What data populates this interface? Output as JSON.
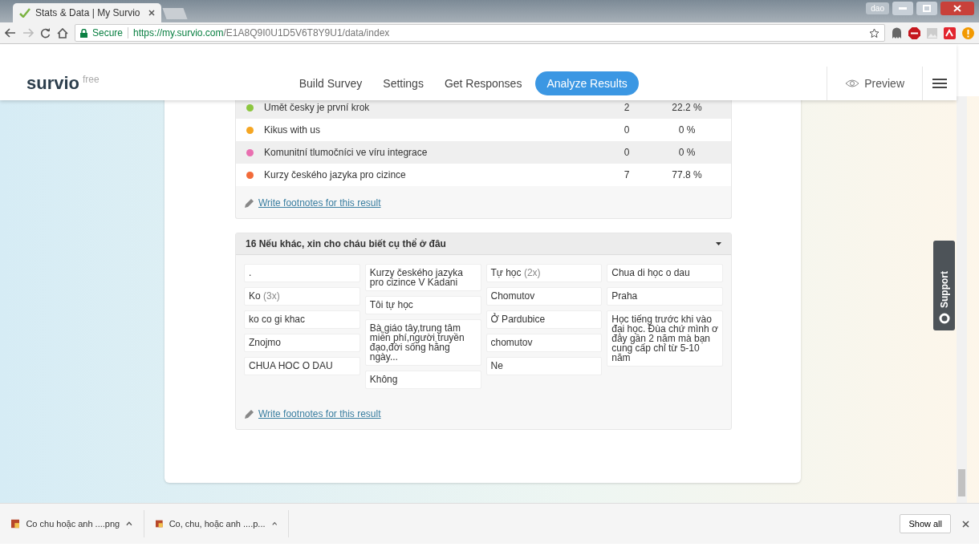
{
  "browser": {
    "tab_title": "Stats & Data | My Survio",
    "secure": "Secure",
    "url_host": "https://my.survio.com",
    "url_path": "/E1A8Q9I0U1D5V6T8Y9U1/data/index",
    "profile": "dao"
  },
  "app": {
    "logo": "survio",
    "plan": "free",
    "nav": [
      {
        "label": "Build Survey",
        "selected": false
      },
      {
        "label": "Settings",
        "selected": false
      },
      {
        "label": "Get Responses",
        "selected": false
      },
      {
        "label": "Analyze Results",
        "selected": true
      }
    ],
    "preview": "Preview"
  },
  "result": {
    "rows": [
      {
        "label": "Umět česky je první krok",
        "count": "2",
        "percent": "22.2 %",
        "color": "#8cc63f"
      },
      {
        "label": "Kikus with us",
        "count": "0",
        "percent": "0 %",
        "color": "#f5a623"
      },
      {
        "label": "Komunitní tlumočníci ve víru integrace",
        "count": "0",
        "percent": "0 %",
        "color": "#e96fb0"
      },
      {
        "label": "Kurzy českého jazyka pro cizince",
        "count": "7",
        "percent": "77.8 %",
        "color": "#f26b3a"
      }
    ],
    "footnote_link": "Write footnotes for this result"
  },
  "question": {
    "title": "16 Nếu khác, xin cho cháu biết cụ thể ở đâu",
    "columns": [
      [
        {
          "text": "."
        },
        {
          "text": "Ko",
          "count": "(3x)"
        },
        {
          "text": "ko co gi khac"
        },
        {
          "text": "Znojmo"
        },
        {
          "text": "CHUA HOC O DAU"
        }
      ],
      [
        {
          "text": "Kurzy českého jazyka pro cizince V Kadani"
        },
        {
          "text": "Tôi tự học"
        },
        {
          "text": "Bà giáo tây,trung tâm miễn phí,người truyền đạo,đời sống hằng ngày..."
        },
        {
          "text": "Không"
        }
      ],
      [
        {
          "text": "Tự học",
          "count": "(2x)"
        },
        {
          "text": "Chomutov"
        },
        {
          "text": "Ở Pardubice"
        },
        {
          "text": "chomutov"
        },
        {
          "text": "Ne"
        }
      ],
      [
        {
          "text": "Chua di học o dau"
        },
        {
          "text": "Praha"
        },
        {
          "text": "Học tiếng trước khi vào đại học. Đùa chứ mình ơ đây gần 2 năm mà bạn cung cấp chỉ từ 5-10 năm"
        }
      ]
    ],
    "footnote_link": "Write footnotes for this result"
  },
  "support": "Support",
  "downloads": {
    "items": [
      "Co chu hoặc anh ....png",
      "Co, chu, hoặc anh ....p..."
    ],
    "show_all": "Show all"
  }
}
